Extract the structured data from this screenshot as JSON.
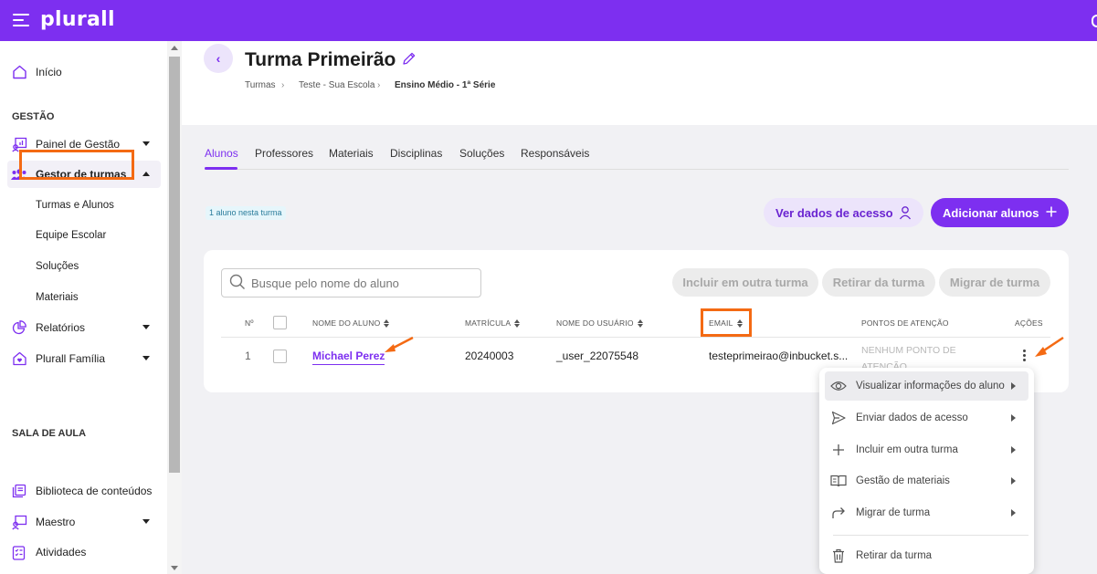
{
  "brand": {
    "name": "plurall",
    "accent": "#7d2ff0",
    "highlight": "#f46a13"
  },
  "sidebar": {
    "home": "Início",
    "section_management": "GESTÃO",
    "items": [
      {
        "label": "Painel de Gestão",
        "icon": "dashboard-icon"
      },
      {
        "label": "Gestor de turmas",
        "icon": "people-group-icon",
        "expanded": true
      },
      {
        "label": "Relatórios",
        "icon": "pie-chart-icon"
      },
      {
        "label": "Plurall Família",
        "icon": "home-heart-icon"
      }
    ],
    "sub_items": [
      "Turmas e Alunos",
      "Equipe Escolar",
      "Soluções",
      "Materiais"
    ],
    "section_class": "SALA DE AULA",
    "class_items": [
      {
        "label": "Biblioteca de conteúdos",
        "icon": "library-icon"
      },
      {
        "label": "Maestro",
        "icon": "presenter-icon"
      },
      {
        "label": "Atividades",
        "icon": "checklist-icon"
      }
    ]
  },
  "header": {
    "title": "Turma Primeirão",
    "breadcrumb": [
      "Turmas",
      "Teste - Sua Escola",
      "Ensino Médio - 1ª Série"
    ]
  },
  "tabs": [
    "Alunos",
    "Professores",
    "Materiais",
    "Disciplinas",
    "Soluções",
    "Responsáveis"
  ],
  "active_tab": "Alunos",
  "count_badge": "1 aluno nesta turma",
  "actions": {
    "view_access": "Ver dados de acesso",
    "add_students": "Adicionar alunos"
  },
  "search": {
    "placeholder": "Busque pelo nome do aluno"
  },
  "bulk_actions": [
    "Incluir em outra turma",
    "Retirar da turma",
    "Migrar de turma"
  ],
  "table": {
    "columns": [
      "Nº",
      "NOME DO ALUNO",
      "MATRÍCULA",
      "NOME DO USUÁRIO",
      "EMAIL",
      "PONTOS DE ATENÇÃO",
      "AÇÕES"
    ],
    "rows": [
      {
        "number": "1",
        "name": "Michael Perez",
        "enrollment": "20240003",
        "username": "_user_22075548",
        "email": "testeprimeirao@inbucket.s...",
        "attention": "NENHUM PONTO DE ATENÇÃO"
      }
    ]
  },
  "context_menu": {
    "items": [
      {
        "label": "Visualizar informações do aluno",
        "icon": "eye-icon",
        "submenu": true
      },
      {
        "label": "Enviar dados de acesso",
        "icon": "send-icon",
        "submenu": true
      },
      {
        "label": "Incluir em outra turma",
        "icon": "plus-icon",
        "submenu": true
      },
      {
        "label": "Gestão de materiais",
        "icon": "book-icon",
        "submenu": true
      },
      {
        "label": "Migrar de turma",
        "icon": "redirect-arrow-icon",
        "submenu": true
      },
      {
        "label": "Retirar da turma",
        "icon": "trash-icon",
        "submenu": false
      }
    ]
  }
}
